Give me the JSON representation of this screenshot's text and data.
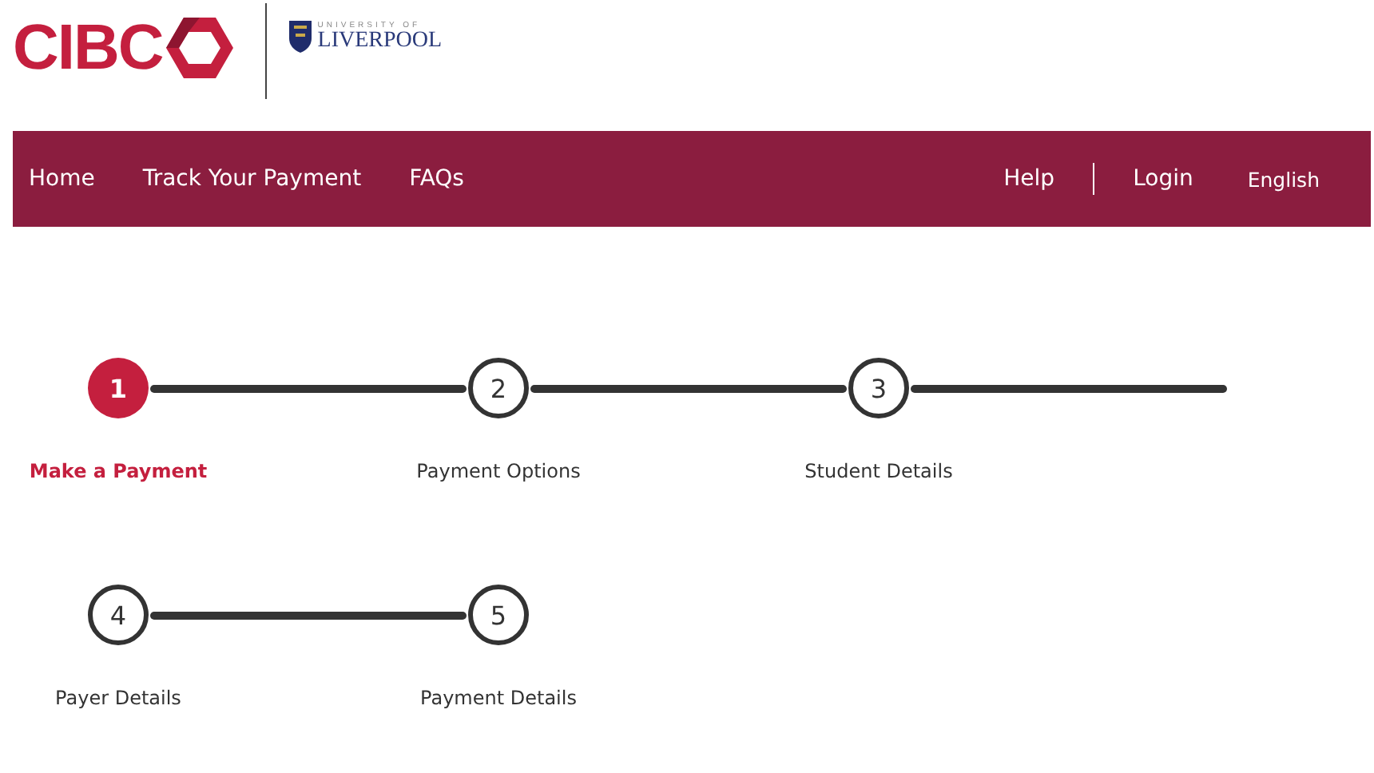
{
  "header": {
    "bank_logo": "CIBC",
    "university_tagline": "UNIVERSITY OF",
    "university_name": "LIVERPOOL"
  },
  "nav": {
    "left": [
      "Home",
      "Track Your Payment",
      "FAQs"
    ],
    "right": [
      {
        "label": "Help",
        "kind": "link"
      },
      {
        "label": "Login",
        "kind": "link"
      },
      {
        "label": "English",
        "kind": "language"
      }
    ]
  },
  "step_rows": [
    {
      "steps": [
        {
          "number": "1",
          "label": "Make a Payment",
          "selected": true,
          "connector": true
        },
        {
          "number": "2",
          "label": "Payment Options",
          "selected": false,
          "connector": true
        },
        {
          "number": "3",
          "label": "Student Details",
          "selected": false,
          "connector": true
        }
      ]
    },
    {
      "steps": [
        {
          "number": "4",
          "label": "Payer Details",
          "selected": false,
          "connector": true
        },
        {
          "number": "5",
          "label": "Payment Details",
          "selected": false,
          "connector": false
        }
      ]
    }
  ]
}
